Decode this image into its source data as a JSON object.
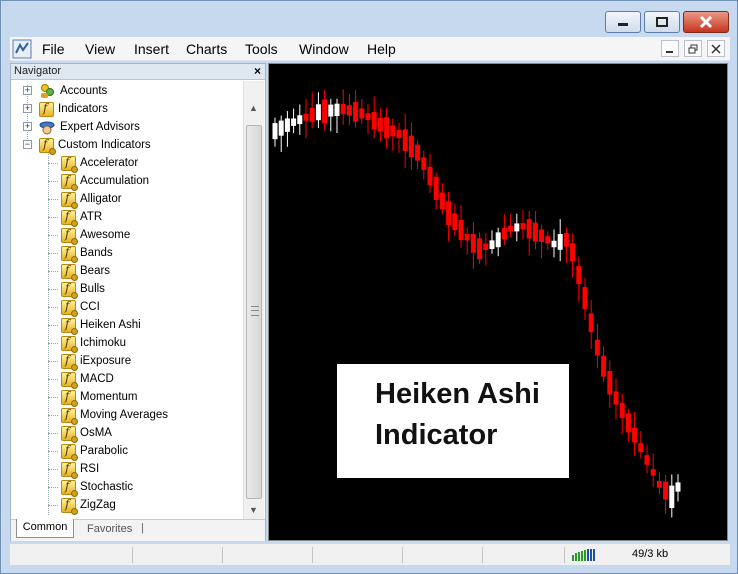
{
  "menu": [
    "File",
    "View",
    "Insert",
    "Charts",
    "Tools",
    "Window",
    "Help"
  ],
  "navigator": {
    "title": "Navigator",
    "roots": [
      {
        "label": "Accounts",
        "icon": "accounts-icon"
      },
      {
        "label": "Indicators",
        "icon": "indicators-folder-icon"
      },
      {
        "label": "Expert Advisors",
        "icon": "expert-advisors-icon"
      },
      {
        "label": "Custom Indicators",
        "icon": "custom-indicators-folder-icon"
      }
    ],
    "custom_indicators": [
      "Accelerator",
      "Accumulation",
      "Alligator",
      "ATR",
      "Awesome",
      "Bands",
      "Bears",
      "Bulls",
      "CCI",
      "Heiken Ashi",
      "Ichimoku",
      "iExposure",
      "MACD",
      "Momentum",
      "Moving Averages",
      "OsMA",
      "Parabolic",
      "RSI",
      "Stochastic",
      "ZigZag"
    ],
    "tabs": {
      "active": "Common",
      "inactive": "Favorites"
    }
  },
  "chart": {
    "overlay_line1": "Heiken Ashi",
    "overlay_line2": "Indicator",
    "bull_color": "#ffffff",
    "bear_color": "#ff0000",
    "background": "#000000"
  },
  "status": {
    "traffic": "49/3 kb"
  }
}
